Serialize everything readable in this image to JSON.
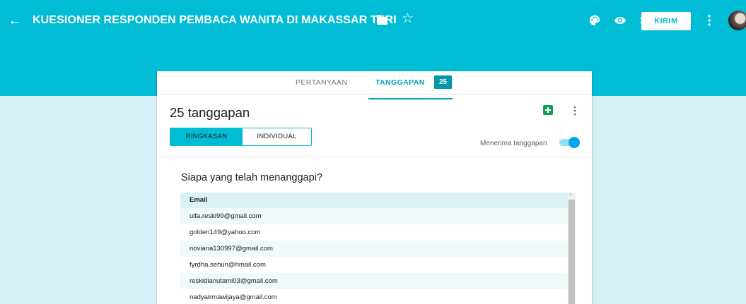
{
  "header": {
    "back_icon": "arrow-left-icon",
    "title": "KUESIONER RESPONDEN PEMBACA WANITA DI MAKASSAR TERI",
    "send_label": "KIRIM",
    "icons": [
      "folder-icon",
      "star-icon",
      "palette-icon",
      "eye-icon",
      "gear-icon",
      "more-vert-icon",
      "avatar"
    ]
  },
  "tabs": {
    "questions_label": "PERTANYAAN",
    "responses_label": "TANGGAPAN",
    "responses_badge": "25"
  },
  "summary": {
    "count_title": "25 tanggapan",
    "segment_summary_label": "RINGKASAN",
    "segment_individual_label": "INDIVIDUAL",
    "accepting_label": "Menerima tanggapan",
    "accepting_on": true
  },
  "respondents": {
    "title": "Siapa yang telah menanggapi?",
    "column_header": "Email",
    "emails": [
      "ulfa.reski99@gmail.com",
      "golden149@yahoo.com",
      "noviana130997@gmail.com",
      "fyrdha.sehun@hmail.com",
      "reskidianutami03@gmail.com",
      "nadyairmawijaya@gmail.com"
    ]
  },
  "colors": {
    "header_bg": "#00bcd4",
    "page_bg": "#d5f1f6",
    "accent": "#00a0b4",
    "badge_bg": "#0097a7",
    "sheets_green": "#0f9d58",
    "toggle_knob": "#00a7ec"
  }
}
